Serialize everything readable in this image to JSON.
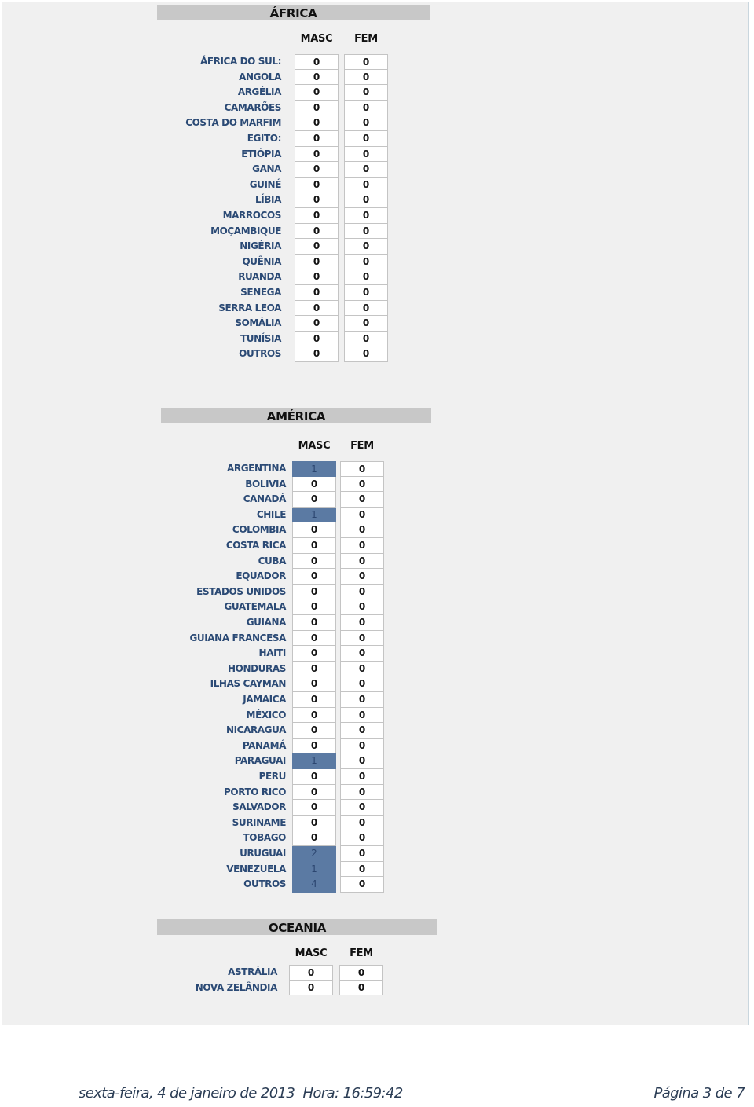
{
  "sections": [
    {
      "title": "ÁFRICA",
      "col_masc": "MASC",
      "col_fem": "FEM",
      "rows": [
        {
          "country": "ÁFRICA DO SUL:",
          "masc": "0",
          "fem": "0",
          "masc_hl": false
        },
        {
          "country": "ANGOLA",
          "masc": "0",
          "fem": "0",
          "masc_hl": false
        },
        {
          "country": "ARGÉLIA",
          "masc": "0",
          "fem": "0",
          "masc_hl": false
        },
        {
          "country": "CAMARÕES",
          "masc": "0",
          "fem": "0",
          "masc_hl": false
        },
        {
          "country": "COSTA DO MARFIM",
          "masc": "0",
          "fem": "0",
          "masc_hl": false
        },
        {
          "country": "EGITO:",
          "masc": "0",
          "fem": "0",
          "masc_hl": false
        },
        {
          "country": "ETIÓPIA",
          "masc": "0",
          "fem": "0",
          "masc_hl": false
        },
        {
          "country": "GANA",
          "masc": "0",
          "fem": "0",
          "masc_hl": false
        },
        {
          "country": "GUINÉ",
          "masc": "0",
          "fem": "0",
          "masc_hl": false
        },
        {
          "country": "LÍBIA",
          "masc": "0",
          "fem": "0",
          "masc_hl": false
        },
        {
          "country": "MARROCOS",
          "masc": "0",
          "fem": "0",
          "masc_hl": false
        },
        {
          "country": "MOÇAMBIQUE",
          "masc": "0",
          "fem": "0",
          "masc_hl": false
        },
        {
          "country": "NIGÉRIA",
          "masc": "0",
          "fem": "0",
          "masc_hl": false
        },
        {
          "country": "QUÊNIA",
          "masc": "0",
          "fem": "0",
          "masc_hl": false
        },
        {
          "country": "RUANDA",
          "masc": "0",
          "fem": "0",
          "masc_hl": false
        },
        {
          "country": "SENEGA",
          "masc": "0",
          "fem": "0",
          "masc_hl": false
        },
        {
          "country": "SERRA LEOA",
          "masc": "0",
          "fem": "0",
          "masc_hl": false
        },
        {
          "country": "SOMÁLIA",
          "masc": "0",
          "fem": "0",
          "masc_hl": false
        },
        {
          "country": "TUNÍSIA",
          "masc": "0",
          "fem": "0",
          "masc_hl": false
        },
        {
          "country": "OUTROS",
          "masc": "0",
          "fem": "0",
          "masc_hl": false
        }
      ]
    },
    {
      "title": "AMÉRICA",
      "col_masc": "MASC",
      "col_fem": "FEM",
      "rows": [
        {
          "country": "ARGENTINA",
          "masc": "1",
          "fem": "0",
          "masc_hl": true
        },
        {
          "country": "BOLIVIA",
          "masc": "0",
          "fem": "0",
          "masc_hl": false
        },
        {
          "country": "CANADÁ",
          "masc": "0",
          "fem": "0",
          "masc_hl": false
        },
        {
          "country": "CHILE",
          "masc": "1",
          "fem": "0",
          "masc_hl": true
        },
        {
          "country": "COLOMBIA",
          "masc": "0",
          "fem": "0",
          "masc_hl": false
        },
        {
          "country": "COSTA RICA",
          "masc": "0",
          "fem": "0",
          "masc_hl": false
        },
        {
          "country": "CUBA",
          "masc": "0",
          "fem": "0",
          "masc_hl": false
        },
        {
          "country": "EQUADOR",
          "masc": "0",
          "fem": "0",
          "masc_hl": false
        },
        {
          "country": "ESTADOS UNIDOS",
          "masc": "0",
          "fem": "0",
          "masc_hl": false
        },
        {
          "country": "GUATEMALA",
          "masc": "0",
          "fem": "0",
          "masc_hl": false
        },
        {
          "country": "GUIANA",
          "masc": "0",
          "fem": "0",
          "masc_hl": false
        },
        {
          "country": "GUIANA FRANCESA",
          "masc": "0",
          "fem": "0",
          "masc_hl": false
        },
        {
          "country": "HAITI",
          "masc": "0",
          "fem": "0",
          "masc_hl": false
        },
        {
          "country": "HONDURAS",
          "masc": "0",
          "fem": "0",
          "masc_hl": false
        },
        {
          "country": "ILHAS CAYMAN",
          "masc": "0",
          "fem": "0",
          "masc_hl": false
        },
        {
          "country": "JAMAICA",
          "masc": "0",
          "fem": "0",
          "masc_hl": false
        },
        {
          "country": "MÉXICO",
          "masc": "0",
          "fem": "0",
          "masc_hl": false
        },
        {
          "country": "NICARAGUA",
          "masc": "0",
          "fem": "0",
          "masc_hl": false
        },
        {
          "country": "PANAMÁ",
          "masc": "0",
          "fem": "0",
          "masc_hl": false
        },
        {
          "country": "PARAGUAI",
          "masc": "1",
          "fem": "0",
          "masc_hl": true
        },
        {
          "country": "PERU",
          "masc": "0",
          "fem": "0",
          "masc_hl": false
        },
        {
          "country": "PORTO RICO",
          "masc": "0",
          "fem": "0",
          "masc_hl": false
        },
        {
          "country": "SALVADOR",
          "masc": "0",
          "fem": "0",
          "masc_hl": false
        },
        {
          "country": "SURINAME",
          "masc": "0",
          "fem": "0",
          "masc_hl": false
        },
        {
          "country": "TOBAGO",
          "masc": "0",
          "fem": "0",
          "masc_hl": false
        },
        {
          "country": "URUGUAI",
          "masc": "2",
          "fem": "0",
          "masc_hl": true
        },
        {
          "country": "VENEZUELA",
          "masc": "1",
          "fem": "0",
          "masc_hl": true
        },
        {
          "country": "OUTROS",
          "masc": "4",
          "fem": "0",
          "masc_hl": true
        }
      ]
    },
    {
      "title": "OCEANIA",
      "col_masc": "MASC",
      "col_fem": "FEM",
      "rows": [
        {
          "country": "ASTRÁLIA",
          "masc": "0",
          "fem": "0",
          "masc_hl": false
        },
        {
          "country": "NOVA ZELÂNDIA",
          "masc": "0",
          "fem": "0",
          "masc_hl": false
        }
      ]
    }
  ],
  "colors": {
    "highlight_cell": "#5b7aa3",
    "label_text": "#2b4a75",
    "band": "#c8c8c8"
  },
  "footer": {
    "date": "sexta-feira, 4 de janeiro de 2013",
    "time_label": "Hora:",
    "time": "16:59:42",
    "date_time": "sexta-feira, 4 de janeiro de 2013  Hora: 16:59:42",
    "page": "Página 3 de 7"
  }
}
